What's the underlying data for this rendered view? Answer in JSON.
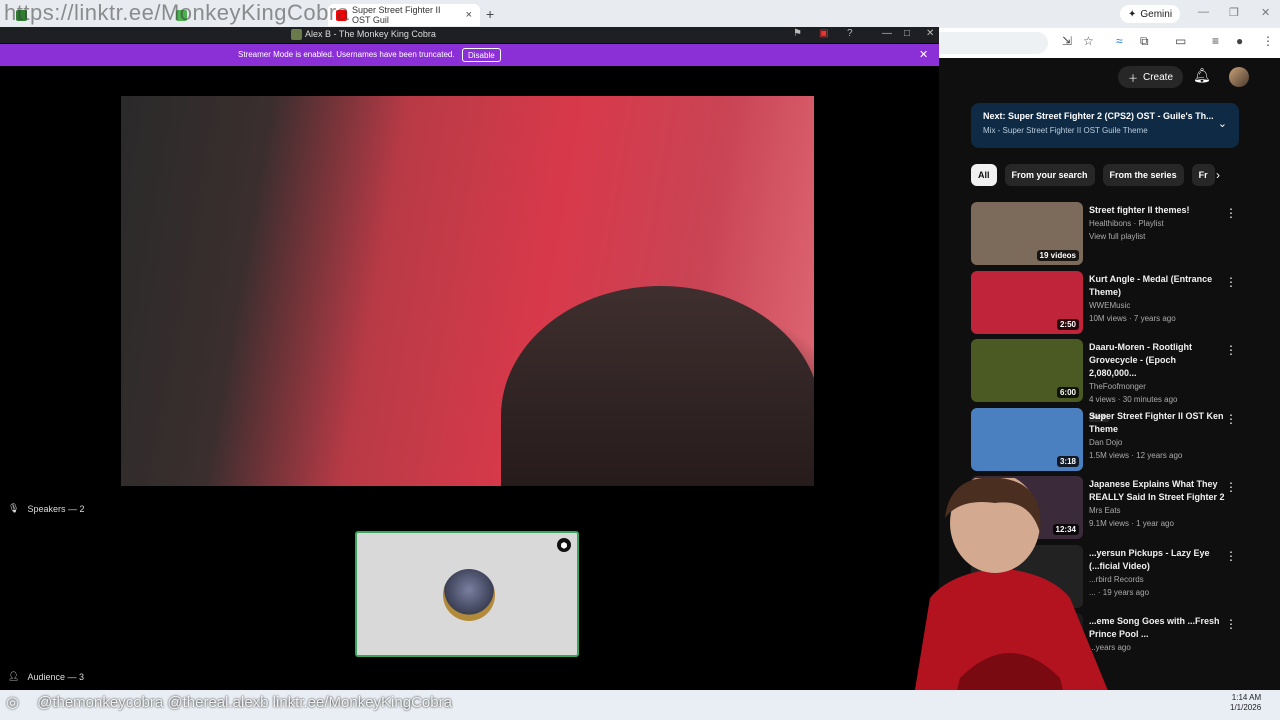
{
  "browser": {
    "watermark": "https://linktr.ee/MonkeyKingCobra",
    "tabs": [
      {
        "label": "",
        "color": "#2e7d32"
      },
      {
        "label": "",
        "color": "#4caf50"
      },
      {
        "label": "Super Street Fighter II OST Guil",
        "color": "#ff0000"
      }
    ],
    "gemini_label": "Gemini",
    "new_tab": "+",
    "win_minimize": "—",
    "win_restore": "❐",
    "win_close": "✕"
  },
  "discord": {
    "window_title": "Alex B - The Monkey King Cobra",
    "banner_message": "Streamer Mode is enabled. Usernames have been truncated.",
    "banner_button": "Disable",
    "speakers_label": "Speakers — 2",
    "audience_label": "Audience — 3"
  },
  "youtube": {
    "create_label": "Create",
    "next_title": "Next: Super Street Fighter 2 (CPS2) OST - Guile's Th...",
    "next_subtitle": "Mix - Super Street Fighter II OST Guile Theme",
    "chips": [
      "All",
      "From your search",
      "From the series",
      "Fr"
    ],
    "videos": [
      {
        "title": "Street fighter II themes!",
        "channel": "Healthibons · Playlist",
        "meta": "View full playlist",
        "duration": "19 videos",
        "badge": "",
        "thumb": "#7c6a5a"
      },
      {
        "title": "Kurt Angle - Medal (Entrance Theme)",
        "channel": "WWEMusic",
        "meta": "10M views · 7 years ago",
        "duration": "2:50",
        "badge": "",
        "thumb": "#c0243b"
      },
      {
        "title": "Daaru-Moren - Rootlight Grovecycle - (Epoch 2,080,000...",
        "channel": "TheFoofmonger",
        "meta": "4 views · 30 minutes ago",
        "duration": "6:00",
        "badge": "New",
        "thumb": "#4b5a22"
      },
      {
        "title": "Super Street Fighter II OST Ken Theme",
        "channel": "Dan Dojo",
        "meta": "1.5M views · 12 years ago",
        "duration": "3:18",
        "badge": "",
        "thumb": "#4a7fc0"
      },
      {
        "title": "Japanese Explains What They REALLY Said In Street Fighter 2",
        "channel": "Mrs Eats",
        "meta": "9.1M views · 1 year ago",
        "duration": "12:34",
        "badge": "",
        "thumb": "#3a2a3a"
      },
      {
        "title": "...yersun Pickups - Lazy Eye (...ficial Video)",
        "channel": "...rbird Records",
        "meta": "... · 19 years ago",
        "duration": "",
        "badge": "",
        "thumb": "#222"
      },
      {
        "title": "...eme Song Goes with ...Fresh Prince Pool ...",
        "channel": "",
        "meta": "...years ago",
        "duration": "",
        "badge": "",
        "thumb": "#1b1b1b"
      }
    ]
  },
  "overlay": {
    "socials_text": "@themonkeycobra  @thereal.alexb  linktr.ee/MonkeyKingCobra",
    "taskbar_search": "Search"
  },
  "clock": {
    "time": "1:14 AM",
    "date": "1/1/2026"
  }
}
